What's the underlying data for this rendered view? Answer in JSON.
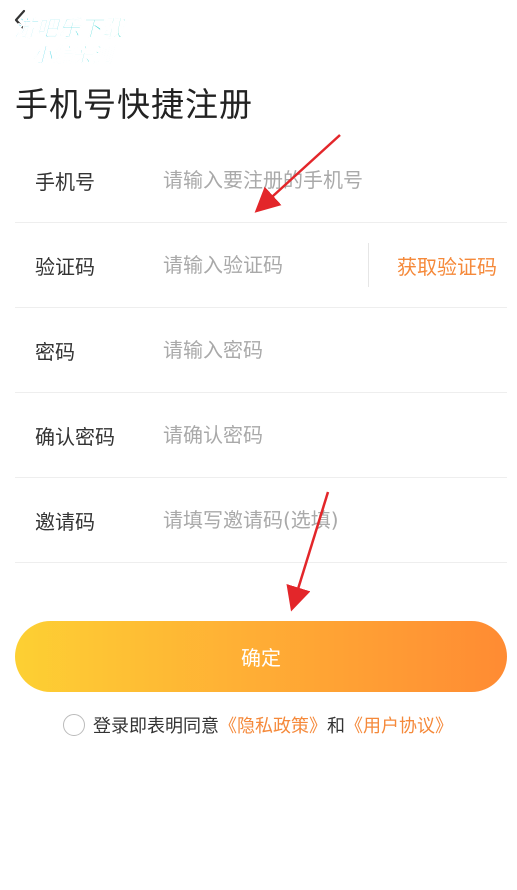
{
  "watermark": {
    "line1": "游吧乐下载",
    "line2": "小编亲测"
  },
  "page": {
    "title": "手机号快捷注册"
  },
  "form": {
    "phone": {
      "label": "手机号",
      "placeholder": "请输入要注册的手机号"
    },
    "code": {
      "label": "验证码",
      "placeholder": "请输入验证码",
      "get_code_label": "获取验证码"
    },
    "password": {
      "label": "密码",
      "placeholder": "请输入密码"
    },
    "confirm_password": {
      "label": "确认密码",
      "placeholder": "请确认密码"
    },
    "invite": {
      "label": "邀请码",
      "placeholder": "请填写邀请码(选填)"
    }
  },
  "actions": {
    "confirm_label": "确定"
  },
  "agreement": {
    "prefix": "登录即表明同意",
    "privacy_link": "《隐私政策》",
    "conjunction": "和",
    "terms_link": "《用户协议》"
  },
  "colors": {
    "accent": "#f5893a",
    "button_start": "#fdd033",
    "button_end": "#ff8b33",
    "annotation_arrow": "#e3262a",
    "watermark": "#19c8e8"
  },
  "icons": {
    "back": "chevron-left-icon",
    "radio": "radio-unchecked-icon"
  }
}
